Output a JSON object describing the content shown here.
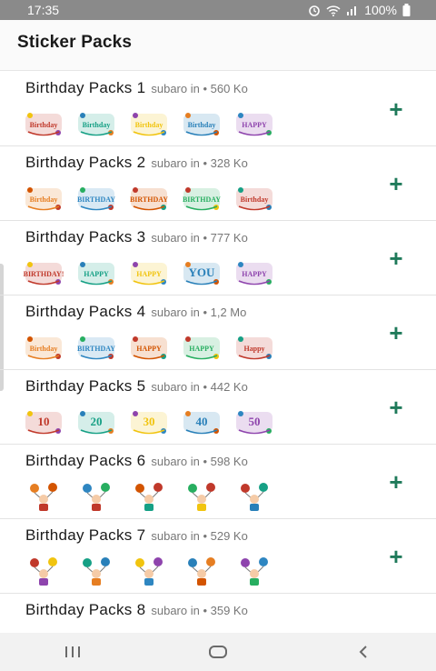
{
  "status_bar": {
    "time": "17:35",
    "battery": "100%",
    "icons": [
      "alarm-icon",
      "wifi-icon",
      "signal-icon",
      "battery-icon"
    ]
  },
  "app_bar": {
    "title": "Sticker Packs"
  },
  "accent_color": "#1f7a5a",
  "packs": [
    {
      "name": "Birthday Packs 1",
      "meta": "subaro in • 560 Ko",
      "add_label": "+",
      "stickers": [
        "Happy Birthday",
        "Happy Birthday",
        "Happy Birthday",
        "Birthday",
        "Happy Birthday"
      ],
      "sticker_texts": [
        "Birthday",
        "Birthday",
        "Birthday",
        "Birthday",
        "HAPPY"
      ]
    },
    {
      "name": "Birthday Packs 2",
      "meta": "subaro in • 328 Ko",
      "add_label": "+",
      "stickers": [
        "Happy Birthday",
        "Happy Birthday",
        "Happy Birthday",
        "Happy Birthday",
        "Happy Birthday"
      ],
      "sticker_texts": [
        "Birthday",
        "BIRTHDAY",
        "BIRTHDAY",
        "BIRTHDAY",
        "Birthday"
      ]
    },
    {
      "name": "Birthday Packs 3",
      "meta": "subaro in • 777 Ko",
      "add_label": "+",
      "stickers": [
        "Happy Birthday",
        "Happy Birthday",
        "Happy Birthday",
        "Happy Birthday",
        "Happy Birthday"
      ],
      "sticker_texts": [
        "BIRTHDAY!",
        "HAPPY",
        "HAPPY",
        "YOU",
        "HAPPY"
      ]
    },
    {
      "name": "Birthday Packs 4",
      "meta": "subaro in • 1,2 Mo",
      "add_label": "+",
      "stickers": [
        "Happy Birthday",
        "Happy Birthday",
        "Happy Birthday",
        "Happy Birthday",
        "Happy Birthday"
      ],
      "sticker_texts": [
        "Birthday",
        "BIRTHDAY",
        "HAPPY",
        "HAPPY",
        "Happy"
      ]
    },
    {
      "name": "Birthday Packs 5",
      "meta": "subaro in • 442 Ko",
      "add_label": "+",
      "stickers": [
        "10",
        "20",
        "30",
        "40",
        "50"
      ],
      "sticker_texts": [
        "10",
        "20",
        "30",
        "40",
        "50"
      ]
    },
    {
      "name": "Birthday Packs 6",
      "meta": "subaro in • 598 Ko",
      "add_label": "+",
      "stickers": [
        "balloon-kid",
        "balloon-kid",
        "balloon-kid",
        "balloon-kid",
        "balloon-kid"
      ],
      "sticker_texts": [
        "",
        "",
        "",
        "",
        ""
      ]
    },
    {
      "name": "Birthday Packs 7",
      "meta": "subaro in • 529 Ko",
      "add_label": "+",
      "stickers": [
        "party-kid",
        "party-kid",
        "party-kid",
        "party-kid",
        "party-kid"
      ],
      "sticker_texts": [
        "",
        "",
        "",
        "",
        ""
      ]
    },
    {
      "name": "Birthday Packs 8",
      "meta": "subaro in • 359 Ko",
      "add_label": "+",
      "stickers": [],
      "sticker_texts": []
    }
  ],
  "nav_bar": {
    "buttons": [
      "recent-apps-icon",
      "home-icon",
      "back-icon"
    ]
  }
}
